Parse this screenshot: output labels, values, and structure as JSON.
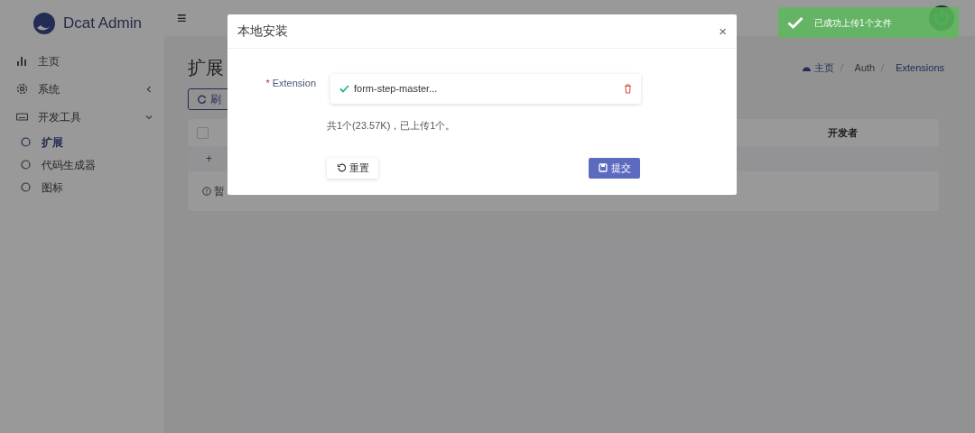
{
  "sidebar": {
    "brand": "Dcat Admin",
    "items": [
      {
        "label": "主页"
      },
      {
        "label": "系统",
        "expanded": false
      },
      {
        "label": "开发工具",
        "expanded": true,
        "children": [
          {
            "label": "扩展",
            "selected": true
          },
          {
            "label": "代码生成器",
            "selected": false
          },
          {
            "label": "图标",
            "selected": false
          }
        ]
      }
    ]
  },
  "header": {
    "menu_glyph": "≡"
  },
  "page": {
    "title": "扩展",
    "breadcrumb": [
      "主页",
      "Auth",
      "Extensions"
    ],
    "refresh_button": "刷",
    "table": {
      "select_all": {
        "checked": false
      },
      "columns": [
        "开发者"
      ],
      "quick_row": "+",
      "empty_text": "暂"
    }
  },
  "modal": {
    "title": "本地安装",
    "close": "×",
    "field": {
      "required_mark": "*",
      "label": "Extension",
      "file": {
        "name": "form-step-master...",
        "uploaded": true
      },
      "summary": "共1个(23.57K)，已上传1个。"
    },
    "buttons": [
      "重置",
      "提交"
    ]
  },
  "toast": {
    "message": "已成功上传1个文件"
  }
}
